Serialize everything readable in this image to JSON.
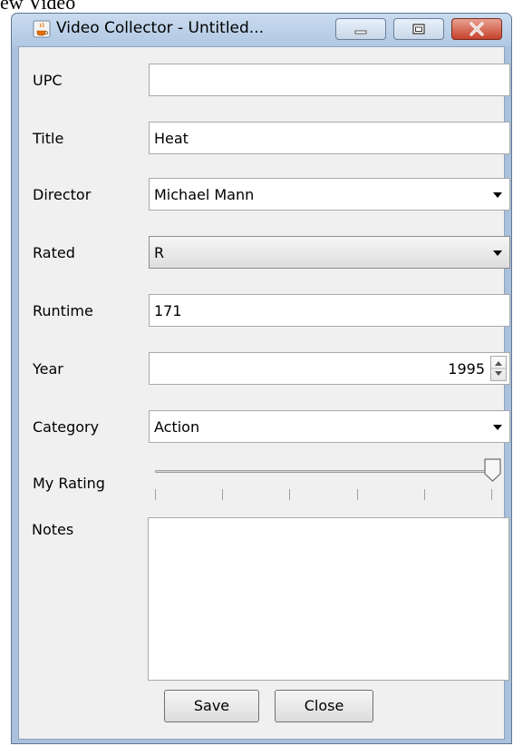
{
  "page_caption": "ew Video",
  "window": {
    "title": "Video Collector - Untitled...",
    "icons": {
      "app": "java-cup-icon",
      "minimize": "minimize-icon",
      "maximize": "maximize-icon",
      "close": "close-icon"
    }
  },
  "form": {
    "upc": {
      "label": "UPC",
      "value": ""
    },
    "title": {
      "label": "Title",
      "value": "Heat"
    },
    "director": {
      "label": "Director",
      "value": "Michael Mann"
    },
    "rated": {
      "label": "Rated",
      "value": "R"
    },
    "runtime": {
      "label": "Runtime",
      "value": "171"
    },
    "year": {
      "label": "Year",
      "value": "1995"
    },
    "category": {
      "label": "Category",
      "value": "Action"
    },
    "my_rating": {
      "label": "My Rating",
      "value_fraction": 1.0
    },
    "notes": {
      "label": "Notes",
      "value": ""
    }
  },
  "buttons": {
    "save": "Save",
    "close": "Close"
  }
}
